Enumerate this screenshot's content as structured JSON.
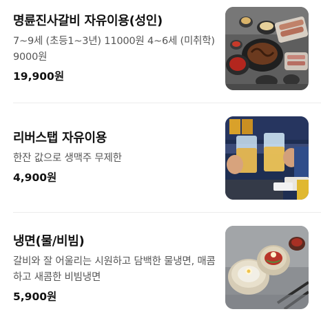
{
  "menu": {
    "items": [
      {
        "name": "명륜진사갈비 자유이용(성인)",
        "description": "7~9세 (초등1~3년) 11000원 4~6세 (미취학) 9000원",
        "price": "19,900원",
        "image_icon": "grilled-galbi-spread-photo"
      },
      {
        "name": "리버스탭 자유이용",
        "description": "한잔 값으로 생맥주 무제한",
        "price": "4,900원",
        "image_icon": "beer-cheers-photo"
      },
      {
        "name": "냉면(물/비빔)",
        "description": "갈비와 잘 어울리는 시원하고 담백한 물냉면, 매콤하고 새콤한 비빔냉면",
        "price": "5,900원",
        "image_icon": "naengmyeon-bowls-photo"
      }
    ]
  }
}
